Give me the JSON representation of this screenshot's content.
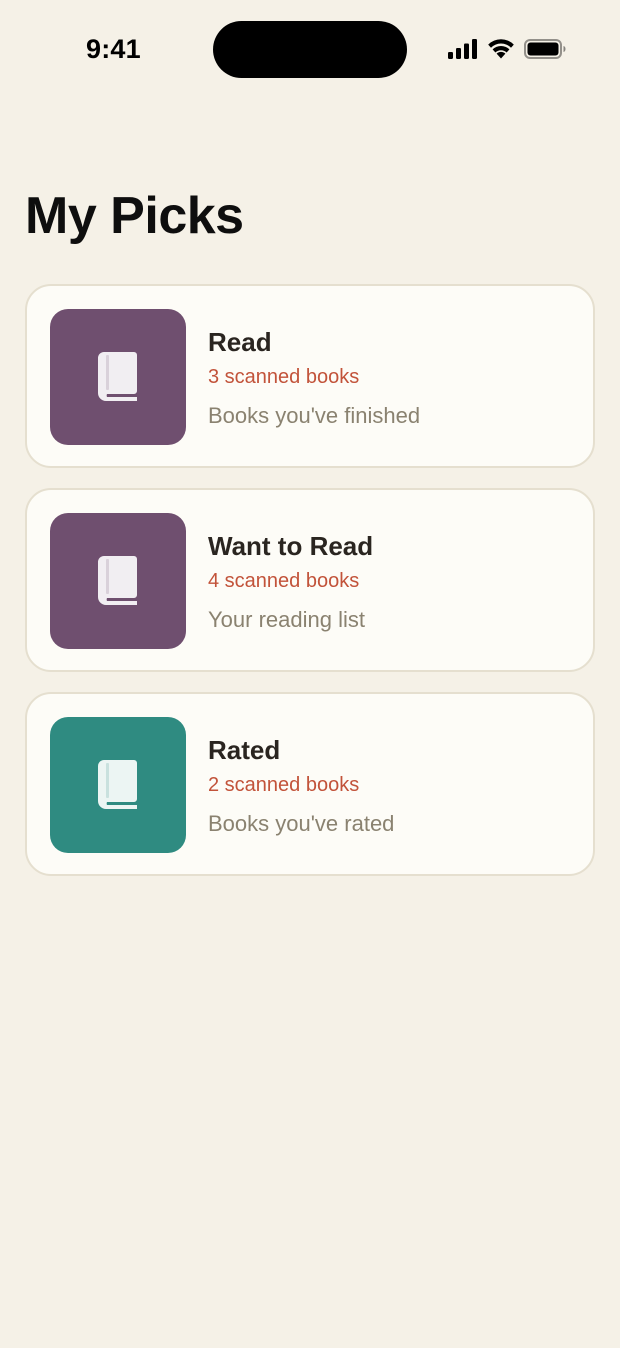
{
  "status_bar": {
    "time": "9:41"
  },
  "page": {
    "title": "My Picks"
  },
  "colors": {
    "background": "#f5f1e7",
    "card_background": "#fdfcf7",
    "card_border": "#e5dfcf",
    "count_text": "#c2533a",
    "description_text": "#8a8270",
    "purple_tile": "#6f4f6f",
    "teal_tile": "#2f8b81"
  },
  "lists": [
    {
      "title": "Read",
      "count_text": "3 scanned books",
      "description": "Books you've finished",
      "icon": "book-icon",
      "tile_color": "#6f4f6f"
    },
    {
      "title": "Want to Read",
      "count_text": "4 scanned books",
      "description": "Your reading list",
      "icon": "book-icon",
      "tile_color": "#6f4f6f"
    },
    {
      "title": "Rated",
      "count_text": "2 scanned books",
      "description": "Books you've rated",
      "icon": "book-icon",
      "tile_color": "#2f8b81"
    }
  ]
}
